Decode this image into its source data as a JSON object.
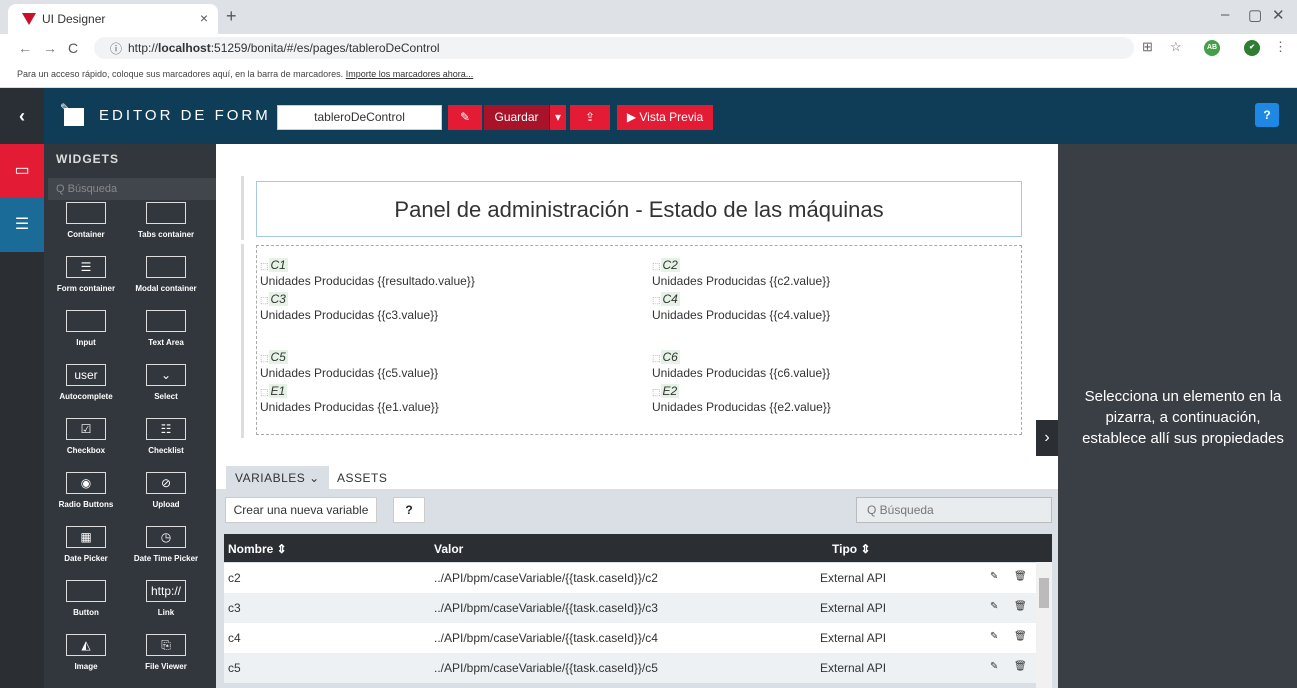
{
  "browser": {
    "tab_title": "UI Designer",
    "close": "×",
    "new_tab": "+",
    "back": "←",
    "forward": "→",
    "reload": "C",
    "url_info": "ⓘ",
    "url_prefix": "http://",
    "url_host": "localhost",
    "url_rest": ":51259/bonita/#/es/pages/tableroDeControl",
    "minimize": "–",
    "maximize": "▢",
    "close_window": "✕",
    "translate_icon": "⊞",
    "star_icon": "☆",
    "ext_label": "AB",
    "menu_icon": "⋮"
  },
  "bookmarks": {
    "text": "Para un acceso rápido, coloque sus marcadores aquí, en la barra de marcadores.",
    "link": "Importe los marcadores ahora..."
  },
  "header": {
    "back": "‹",
    "title": "EDITOR DE FORM",
    "form_name": "tableroDeControl",
    "save": "Guardar",
    "preview": "▶ Vista Previa",
    "help": "?",
    "tag_icon": "✎",
    "caret": "▾",
    "export_icon": "⇪"
  },
  "widgets": {
    "title": "WIDGETS",
    "search_placeholder": "Q Búsqueda",
    "items": [
      {
        "label": "Container",
        "glyph": ""
      },
      {
        "label": "Tabs container",
        "glyph": ""
      },
      {
        "label": "Form container",
        "glyph": "☰"
      },
      {
        "label": "Modal container",
        "glyph": ""
      },
      {
        "label": "Input",
        "glyph": ""
      },
      {
        "label": "Text Area",
        "glyph": ""
      },
      {
        "label": "Autocomplete",
        "glyph": "user"
      },
      {
        "label": "Select",
        "glyph": "⌄"
      },
      {
        "label": "Checkbox",
        "glyph": "☑"
      },
      {
        "label": "Checklist",
        "glyph": "☷"
      },
      {
        "label": "Radio Buttons",
        "glyph": "◉"
      },
      {
        "label": "Upload",
        "glyph": "⊘"
      },
      {
        "label": "Date Picker",
        "glyph": "▦"
      },
      {
        "label": "Date Time Picker",
        "glyph": "◷"
      },
      {
        "label": "Button",
        "glyph": ""
      },
      {
        "label": "Link",
        "glyph": "http://"
      },
      {
        "label": "Image",
        "glyph": "◭"
      },
      {
        "label": "File Viewer",
        "glyph": "⎘"
      }
    ]
  },
  "canvas": {
    "title": "Panel de administración - Estado de las máquinas",
    "machines": [
      {
        "key": "C1",
        "text": "Unidades Producidas {{resultado.value}}"
      },
      {
        "key": "C2",
        "text": "Unidades Producidas {{c2.value}}"
      },
      {
        "key": "C3",
        "text": "Unidades Producidas {{c3.value}}"
      },
      {
        "key": "C4",
        "text": "Unidades Producidas {{c4.value}}"
      },
      {
        "key": "C5",
        "text": "Unidades Producidas {{c5.value}}"
      },
      {
        "key": "C6",
        "text": "Unidades Producidas {{c6.value}}"
      },
      {
        "key": "E1",
        "text": "Unidades Producidas {{e1.value}}"
      },
      {
        "key": "E2",
        "text": "Unidades Producidas {{e2.value}}"
      }
    ],
    "key_prefix": "⬚"
  },
  "variables": {
    "tab_variables": "VARIABLES ⌄",
    "tab_assets": "ASSETS",
    "create": "Crear una nueva variable",
    "help": "?",
    "search": "Q Búsqueda",
    "columns": [
      "Nombre ⇕",
      "Valor",
      "Tipo ⇕"
    ],
    "rows": [
      {
        "name": "c2",
        "value": "../API/bpm/caseVariable/{{task.caseId}}/c2",
        "type": "External API"
      },
      {
        "name": "c3",
        "value": "../API/bpm/caseVariable/{{task.caseId}}/c3",
        "type": "External API"
      },
      {
        "name": "c4",
        "value": "../API/bpm/caseVariable/{{task.caseId}}/c4",
        "type": "External API"
      },
      {
        "name": "c5",
        "value": "../API/bpm/caseVariable/{{task.caseId}}/c5",
        "type": "External API"
      }
    ],
    "edit_icon": "✎",
    "delete_icon": "🗑"
  },
  "properties": {
    "message": "Selecciona un elemento en la pizarra, a continuación, establece allí sus propiedades",
    "expand": "›"
  },
  "colors": {
    "header": "#0f3d57",
    "accent": "#e31b34",
    "panel": "#32373d"
  }
}
